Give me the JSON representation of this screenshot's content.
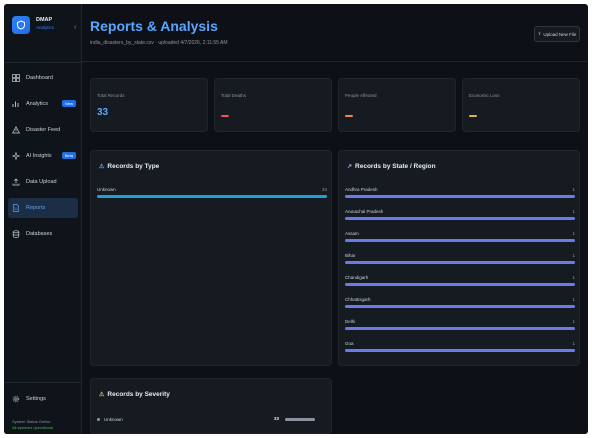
{
  "brand": {
    "name": "DMAP",
    "sub": "Analytics",
    "logo_icon": "shield-logo-icon"
  },
  "sidebar": {
    "items": [
      {
        "label": "Dashboard",
        "icon": "grid-icon",
        "active": false
      },
      {
        "label": "Analytics",
        "icon": "chart-icon",
        "badge": "New",
        "active": false
      },
      {
        "label": "Disaster Feed",
        "icon": "alert-icon",
        "active": false
      },
      {
        "label": "AI Insights",
        "icon": "sparkle-icon",
        "badge": "Beta",
        "active": false
      },
      {
        "label": "Data Upload",
        "icon": "upload-icon",
        "active": false
      },
      {
        "label": "Reports",
        "icon": "document-icon",
        "active": true
      },
      {
        "label": "Databases",
        "icon": "database-icon",
        "active": false
      }
    ],
    "settings_label": "Settings",
    "status_title": "System Status Online",
    "status_text": "All systems operational"
  },
  "header": {
    "title": "Reports & Analysis",
    "subtitle": "india_disasters_by_state.csv · uploaded 4/7/2026, 2:11:55 AM",
    "upload_label": "Upload New File"
  },
  "stats": [
    {
      "label": "Total Records",
      "value": "33",
      "color": "#58a6ff"
    },
    {
      "label": "Total Deaths",
      "value": null,
      "color": "#f85149"
    },
    {
      "label": "People Affected",
      "value": null,
      "color": "#f0883e"
    },
    {
      "label": "Economic Loss",
      "value": null,
      "color": "#e3b341"
    }
  ],
  "by_type": {
    "title": "Records by Type",
    "items": [
      {
        "label": "Unknown",
        "count": "33",
        "fraction": 1.0
      }
    ],
    "bar_color": "#1f9fd4"
  },
  "by_state": {
    "title": "Records by State / Region",
    "items": [
      {
        "label": "Andhra Pradesh",
        "count": "1",
        "fraction": 1.0
      },
      {
        "label": "Arunachal Pradesh",
        "count": "1",
        "fraction": 1.0
      },
      {
        "label": "Assam",
        "count": "1",
        "fraction": 1.0
      },
      {
        "label": "Bihar",
        "count": "1",
        "fraction": 1.0
      },
      {
        "label": "Chandigarh",
        "count": "1",
        "fraction": 1.0
      },
      {
        "label": "Chhattisgarh",
        "count": "1",
        "fraction": 1.0
      },
      {
        "label": "Delhi",
        "count": "1",
        "fraction": 1.0
      },
      {
        "label": "Goa",
        "count": "1",
        "fraction": 1.0
      }
    ],
    "bar_color": "#6c7ae8"
  },
  "by_severity": {
    "title": "Records by Severity",
    "items": [
      {
        "label": "Unknown",
        "count": "33",
        "fraction": 1.0
      }
    ],
    "icon_color": "#e3b341"
  },
  "colors": {
    "accent": "#58a6ff",
    "background": "#0d1117",
    "card": "#161b22"
  }
}
